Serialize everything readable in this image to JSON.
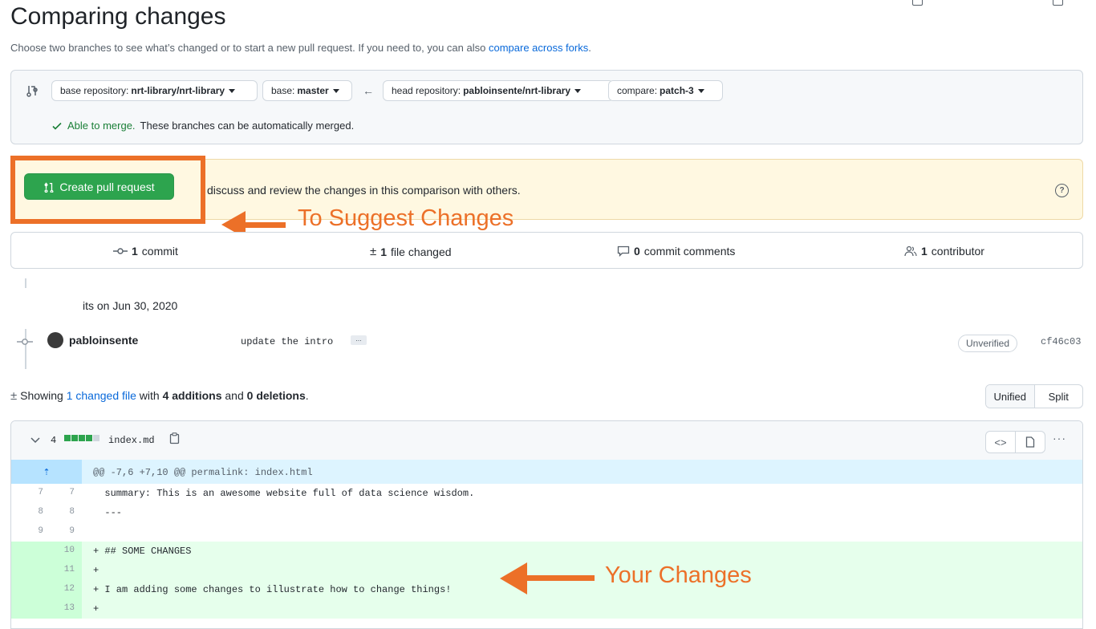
{
  "page": {
    "title": "Comparing changes",
    "subtitle_prefix": "Choose two branches to see what’s changed or to start a new pull request. If you need to, you can also ",
    "subtitle_link": "compare across forks",
    "subtitle_suffix": "."
  },
  "range": {
    "base_repo_prefix": "base repository:",
    "base_repo_value": "nrt-library/nrt-library",
    "base_prefix": "base:",
    "base_value": "master",
    "arrow": "←",
    "head_repo_prefix": "head repository:",
    "head_repo_value": "pabloinsente/nrt-library",
    "compare_prefix": "compare:",
    "compare_value": "patch-3",
    "merge_status_strong": "Able to merge.",
    "merge_status_text": "These branches can be automatically merged."
  },
  "banner": {
    "button_label": "Create pull request",
    "text": "discuss and review the changes in this comparison with others."
  },
  "annotations": {
    "suggest": "To Suggest Changes",
    "yours": "Your Changes",
    "color": "#ec7028"
  },
  "stats": {
    "commits_count": "1",
    "commits_label": "commit",
    "files_count": "1",
    "files_label": "file changed",
    "comments_count": "0",
    "comments_label": "commit comments",
    "contributors_count": "1",
    "contributors_label": "contributor"
  },
  "commits": {
    "date_label": "its on Jun 30, 2020",
    "items": [
      {
        "author": "pabloinsente",
        "message": "update the intro",
        "badge": "Unverified",
        "sha": "cf46c03"
      }
    ]
  },
  "summary": {
    "prefix": "Showing ",
    "link": "1 changed file",
    "mid1": " with ",
    "additions": "4 additions",
    "mid2": " and ",
    "deletions": "0 deletions",
    "suffix": ".",
    "view_unified": "Unified",
    "view_split": "Split"
  },
  "file": {
    "changes": "4",
    "name": "index.md",
    "hunk_header": "@@ -7,6 +7,10 @@ permalink: index.html",
    "lines": [
      {
        "old": "7",
        "new": "7",
        "text": "  summary: This is an awesome website full of data science wisdom.",
        "added": false
      },
      {
        "old": "8",
        "new": "8",
        "text": "  ---",
        "added": false
      },
      {
        "old": "9",
        "new": "9",
        "text": "",
        "added": false
      },
      {
        "old": "",
        "new": "10",
        "text": "+ ## SOME CHANGES",
        "added": true
      },
      {
        "old": "",
        "new": "11",
        "text": "+",
        "added": true
      },
      {
        "old": "",
        "new": "12",
        "text": "+ I am adding some changes to illustrate how to change things!",
        "added": true
      },
      {
        "old": "",
        "new": "13",
        "text": "+",
        "added": true
      }
    ]
  }
}
